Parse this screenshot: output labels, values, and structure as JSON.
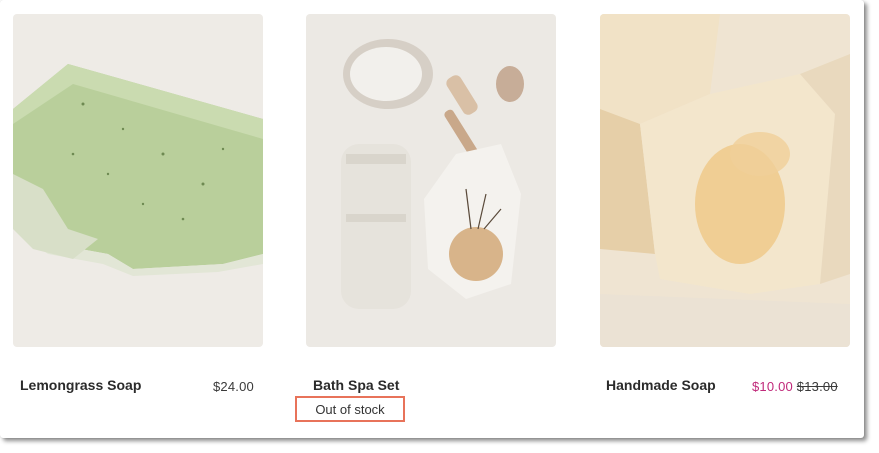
{
  "products": [
    {
      "name": "Lemongrass Soap",
      "price": "$24.00"
    },
    {
      "name": "Bath Spa Set",
      "stock_status": "Out of stock"
    },
    {
      "name": "Handmade Soap",
      "sale_price": "$10.00",
      "original_price": "$13.00"
    }
  ],
  "colors": {
    "sale_price": "#c0297a",
    "highlight_border": "#e8735a"
  }
}
